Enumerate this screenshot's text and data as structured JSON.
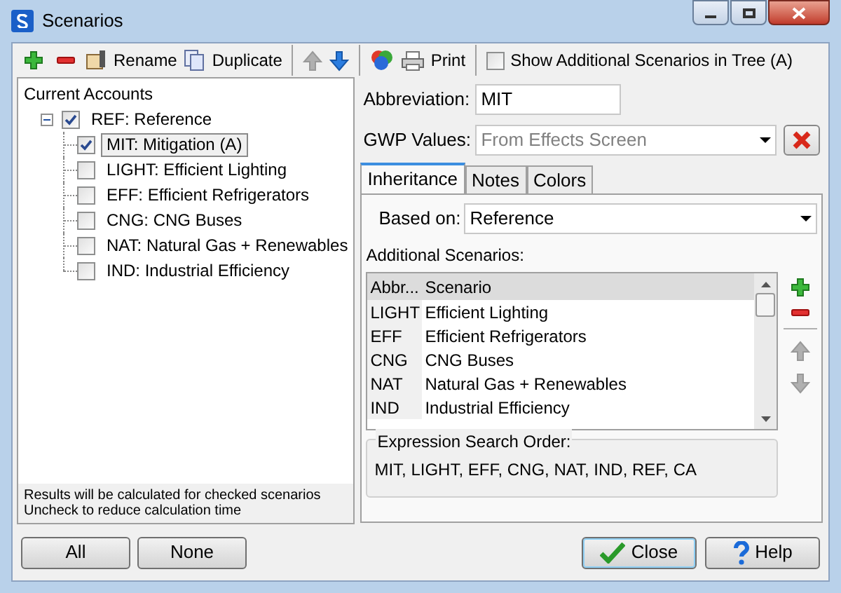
{
  "window": {
    "title": "Scenarios"
  },
  "toolbar": {
    "items": [
      {
        "kind": "add"
      },
      {
        "kind": "remove"
      },
      {
        "kind": "rename",
        "label": "Rename"
      },
      {
        "kind": "duplicate",
        "label": "Duplicate"
      },
      {
        "kind": "separator"
      },
      {
        "kind": "up",
        "disabled": true
      },
      {
        "kind": "down",
        "disabled": false
      },
      {
        "kind": "separator"
      },
      {
        "kind": "colors"
      },
      {
        "kind": "print",
        "label": "Print"
      },
      {
        "kind": "separator"
      },
      {
        "kind": "checkbox",
        "label": "Show Additional Scenarios in Tree (A)",
        "checked": false
      }
    ]
  },
  "tree": {
    "heading": "Current Accounts",
    "items": [
      {
        "label": "REF: Reference",
        "checked": true,
        "selected": false,
        "expanded": true,
        "children": [
          {
            "label": "MIT: Mitigation (A)",
            "checked": true,
            "selected": true
          },
          {
            "label": "LIGHT: Efficient Lighting",
            "checked": false,
            "selected": false
          },
          {
            "label": "EFF: Efficient Refrigerators",
            "checked": false,
            "selected": false
          },
          {
            "label": "CNG: CNG Buses",
            "checked": false,
            "selected": false
          },
          {
            "label": "NAT: Natural Gas + Renewables",
            "checked": false,
            "selected": false
          },
          {
            "label": "IND: Industrial Efficiency",
            "checked": false,
            "selected": false
          }
        ]
      }
    ],
    "note": [
      "Results will be calculated for checked scenarios",
      "Uncheck to reduce calculation time"
    ]
  },
  "abbreviation": {
    "label": "Abbreviation:",
    "value": "MIT"
  },
  "gwp": {
    "label": "GWP Values:",
    "value": "From Effects Screen"
  },
  "tabs": [
    {
      "label": "Inheritance",
      "selected": true
    },
    {
      "label": "Notes",
      "selected": false
    },
    {
      "label": "Colors",
      "selected": false
    }
  ],
  "based_on": {
    "label": "Based on:",
    "value": "Reference"
  },
  "additional": {
    "label": "Additional Scenarios:",
    "columns": [
      "Abbr...",
      "Scenario"
    ],
    "rows": [
      [
        "LIGHT",
        "Efficient Lighting"
      ],
      [
        "EFF",
        "Efficient Refrigerators"
      ],
      [
        "CNG",
        "CNG Buses"
      ],
      [
        "NAT",
        "Natural Gas + Renewables"
      ],
      [
        "IND",
        "Industrial Efficiency"
      ]
    ]
  },
  "search_order": {
    "label": "Expression Search Order:",
    "value": "MIT, LIGHT, EFF, CNG, NAT, IND, REF, CA"
  },
  "buttons_left": [
    "All",
    "None"
  ],
  "buttons_right": [
    {
      "kind": "close",
      "label": "Close"
    },
    {
      "kind": "help",
      "label": "Help"
    }
  ]
}
